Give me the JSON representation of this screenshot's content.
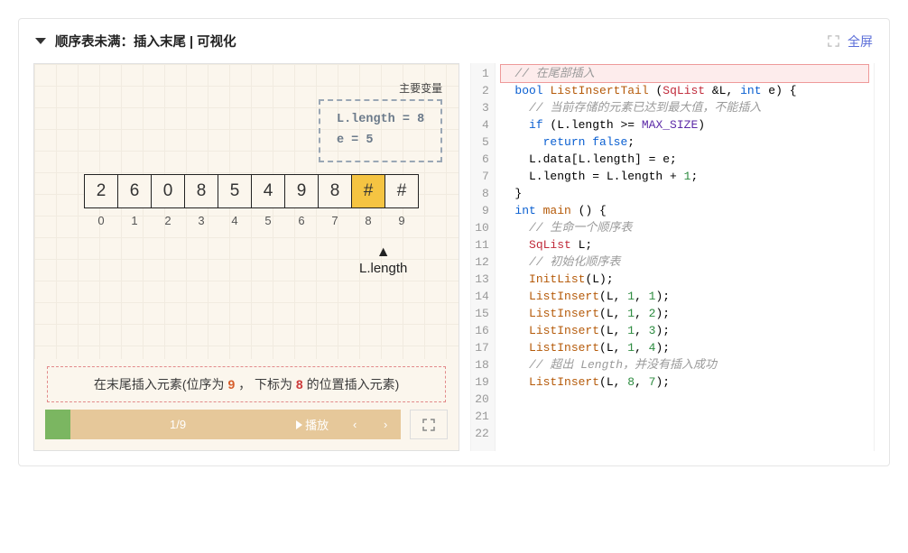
{
  "header": {
    "title": "顺序表未满：插入末尾 | 可视化",
    "fullscreen_label": "全屏"
  },
  "viz": {
    "vars_title": "主要变量",
    "vars": "L.length = 8\ne = 5",
    "cells": [
      "2",
      "6",
      "0",
      "8",
      "5",
      "4",
      "9",
      "8",
      "#",
      "#"
    ],
    "highlight_index": 8,
    "indices": [
      "0",
      "1",
      "2",
      "3",
      "4",
      "5",
      "6",
      "7",
      "8",
      "9"
    ],
    "pointer_label": "L.length",
    "caption_pre": "在末尾插入元素(位序为 ",
    "caption_rank": "9",
    "caption_mid": " ， 下标为 ",
    "caption_idx": "8",
    "caption_post": " 的位置插入元素)",
    "progress": "1/9",
    "play_label": "播放"
  },
  "code": {
    "lines": [
      {
        "n": 1,
        "hl": true,
        "tokens": [
          [
            "  // 在尾部插入",
            "cm"
          ]
        ]
      },
      {
        "n": 2,
        "tokens": [
          [
            "  ",
            ""
          ],
          [
            "bool",
            "kw"
          ],
          [
            " ",
            ""
          ],
          [
            "ListInsertTail",
            "fn"
          ],
          [
            " (",
            ""
          ],
          [
            "SqList",
            "type"
          ],
          [
            " &L, ",
            ""
          ],
          [
            "int",
            "kw"
          ],
          [
            " e) {",
            ""
          ]
        ]
      },
      {
        "n": 3,
        "tokens": [
          [
            "    // 当前存储的元素已达到最大值，不能插入",
            "cm"
          ]
        ]
      },
      {
        "n": 4,
        "tokens": [
          [
            "    ",
            ""
          ],
          [
            "if",
            "kw"
          ],
          [
            " (L.length >= ",
            ""
          ],
          [
            "MAX_SIZE",
            "const"
          ],
          [
            ")",
            ""
          ]
        ]
      },
      {
        "n": 5,
        "tokens": [
          [
            "      ",
            ""
          ],
          [
            "return",
            "kw"
          ],
          [
            " ",
            ""
          ],
          [
            "false",
            "kw"
          ],
          [
            ";",
            ""
          ]
        ]
      },
      {
        "n": 6,
        "tokens": [
          [
            "",
            ""
          ]
        ]
      },
      {
        "n": 7,
        "tokens": [
          [
            "    L.data[L.length] = e;",
            ""
          ]
        ]
      },
      {
        "n": 8,
        "tokens": [
          [
            "    L.length = L.length + ",
            ""
          ],
          [
            "1",
            "num"
          ],
          [
            ";",
            ""
          ]
        ]
      },
      {
        "n": 9,
        "tokens": [
          [
            "  }",
            ""
          ]
        ]
      },
      {
        "n": 10,
        "tokens": [
          [
            "",
            ""
          ]
        ]
      },
      {
        "n": 11,
        "tokens": [
          [
            "  ",
            ""
          ],
          [
            "int",
            "kw"
          ],
          [
            " ",
            ""
          ],
          [
            "main",
            "fn"
          ],
          [
            " () {",
            ""
          ]
        ]
      },
      {
        "n": 12,
        "tokens": [
          [
            "    // 生命一个顺序表",
            "cm"
          ]
        ]
      },
      {
        "n": 13,
        "tokens": [
          [
            "    ",
            ""
          ],
          [
            "SqList",
            "type"
          ],
          [
            " L;",
            ""
          ]
        ]
      },
      {
        "n": 14,
        "tokens": [
          [
            "    // 初始化顺序表",
            "cm"
          ]
        ]
      },
      {
        "n": 15,
        "tokens": [
          [
            "    ",
            ""
          ],
          [
            "InitList",
            "fn"
          ],
          [
            "(L);",
            ""
          ]
        ]
      },
      {
        "n": 16,
        "tokens": [
          [
            "",
            ""
          ]
        ]
      },
      {
        "n": 17,
        "tokens": [
          [
            "    ",
            ""
          ],
          [
            "ListInsert",
            "fn"
          ],
          [
            "(L, ",
            ""
          ],
          [
            "1",
            "num"
          ],
          [
            ", ",
            ""
          ],
          [
            "1",
            "num"
          ],
          [
            ");",
            ""
          ]
        ]
      },
      {
        "n": 18,
        "tokens": [
          [
            "    ",
            ""
          ],
          [
            "ListInsert",
            "fn"
          ],
          [
            "(L, ",
            ""
          ],
          [
            "1",
            "num"
          ],
          [
            ", ",
            ""
          ],
          [
            "2",
            "num"
          ],
          [
            ");",
            ""
          ]
        ]
      },
      {
        "n": 19,
        "tokens": [
          [
            "    ",
            ""
          ],
          [
            "ListInsert",
            "fn"
          ],
          [
            "(L, ",
            ""
          ],
          [
            "1",
            "num"
          ],
          [
            ", ",
            ""
          ],
          [
            "3",
            "num"
          ],
          [
            ");",
            ""
          ]
        ]
      },
      {
        "n": 20,
        "tokens": [
          [
            "    ",
            ""
          ],
          [
            "ListInsert",
            "fn"
          ],
          [
            "(L, ",
            ""
          ],
          [
            "1",
            "num"
          ],
          [
            ", ",
            ""
          ],
          [
            "4",
            "num"
          ],
          [
            ");",
            ""
          ]
        ]
      },
      {
        "n": 21,
        "tokens": [
          [
            "    // 超出 Length，并没有插入成功",
            "cm"
          ]
        ]
      },
      {
        "n": 22,
        "tokens": [
          [
            "    ",
            ""
          ],
          [
            "ListInsert",
            "fn"
          ],
          [
            "(L, ",
            ""
          ],
          [
            "8",
            "num"
          ],
          [
            ", ",
            ""
          ],
          [
            "7",
            "num"
          ],
          [
            ");",
            ""
          ]
        ]
      }
    ]
  }
}
